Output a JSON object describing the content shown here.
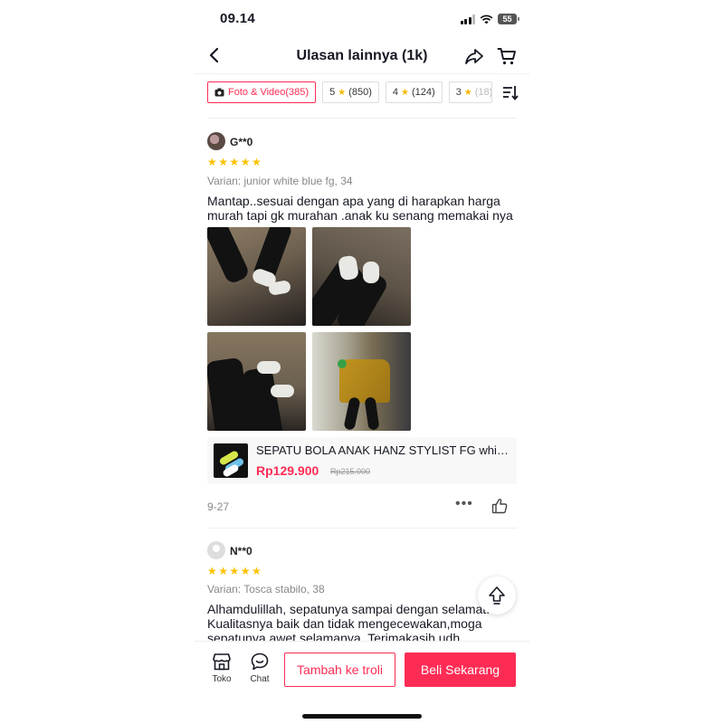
{
  "status_bar": {
    "time": "09.14",
    "battery": "55"
  },
  "header": {
    "title": "Ulasan lainnya (1k)"
  },
  "filters": [
    {
      "label": "Foto & Video(385)",
      "active": true
    },
    {
      "num": "5",
      "count": "(850)"
    },
    {
      "num": "4",
      "count": "(124)"
    },
    {
      "num": "3",
      "count": "(18)"
    }
  ],
  "reviews": [
    {
      "username": "G**0",
      "stars": "★★★★★",
      "variant": "Varian: junior white blue fg, 34",
      "text": "Mantap..sesuai dengan apa yang di harapkan harga murah tapi gk murahan .anak ku senang memakai nya",
      "product": {
        "name": "SEPATU BOLA ANAK HANZ STYLIST FG white blue",
        "price": "Rp129.900",
        "old_price": "Rp215.000"
      },
      "date": "9-27",
      "more": "•••"
    },
    {
      "username": "N**0",
      "stars": "★★★★★",
      "variant": "Varian: Tosca stabilo, 38",
      "text": "Alhamdulillah, sepatunya sampai dengan selamat. Kualitasnya baik dan tidak mengecewakan,moga sepatunya awet selamanya. Terimakasih udh"
    }
  ],
  "bottom_bar": {
    "shop_label": "Toko",
    "chat_label": "Chat",
    "add_cart_label": "Tambah ke troli",
    "buy_label": "Beli Sekarang"
  },
  "colors": {
    "accent": "#fe2c55",
    "star": "#fbc200"
  }
}
